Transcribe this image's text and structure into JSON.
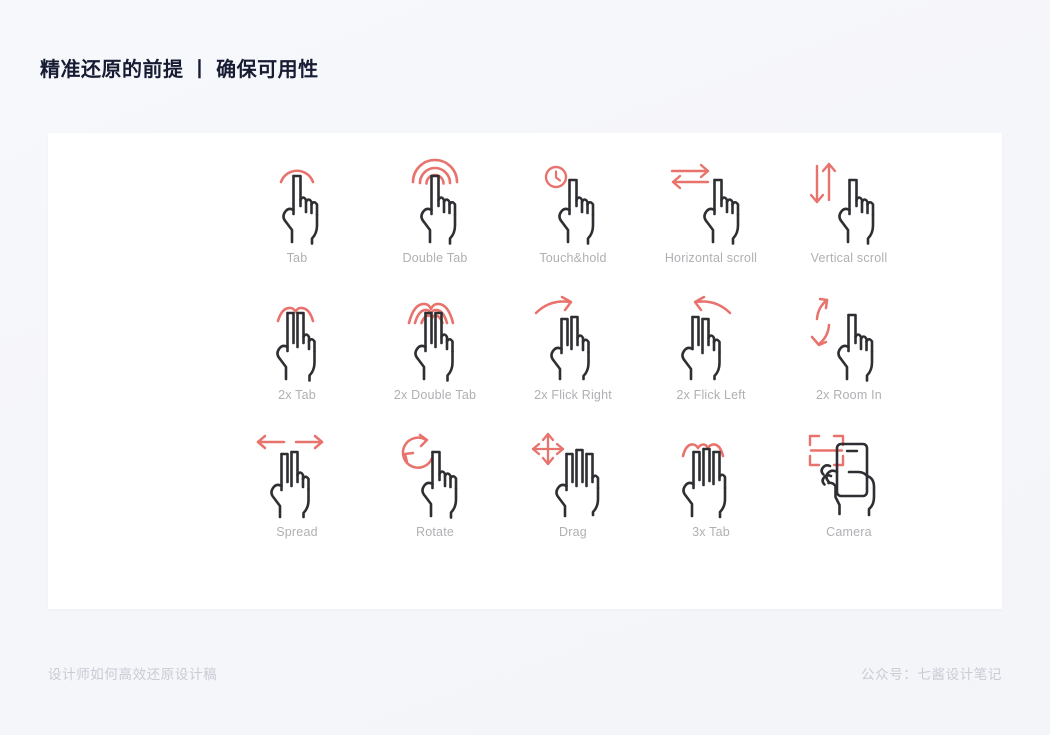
{
  "page": {
    "title": "精准还原的前提 丨 确保可用性",
    "background_color": "#f6f7fb",
    "card_color": "#ffffff",
    "accent_color": "#e8726c",
    "stroke_color": "#2f2f33",
    "label_color": "#b0b0b4"
  },
  "gestures": [
    {
      "label": "Tab",
      "icon": "one-finger-tap-icon"
    },
    {
      "label": "Double Tab",
      "icon": "one-finger-double-tap-icon"
    },
    {
      "label": "Touch&hold",
      "icon": "one-finger-touch-hold-icon"
    },
    {
      "label": "Horizontal scroll",
      "icon": "one-finger-horizontal-scroll-icon"
    },
    {
      "label": "Vertical scroll",
      "icon": "one-finger-vertical-scroll-icon"
    },
    {
      "label": "2x Tab",
      "icon": "two-finger-tap-icon"
    },
    {
      "label": "2x Double Tab",
      "icon": "two-finger-double-tap-icon"
    },
    {
      "label": "2x Flick Right",
      "icon": "two-finger-flick-right-icon"
    },
    {
      "label": "2x Flick Left",
      "icon": "two-finger-flick-left-icon"
    },
    {
      "label": "2x Room In",
      "icon": "two-finger-zoom-in-icon"
    },
    {
      "label": "Spread",
      "icon": "two-finger-spread-icon"
    },
    {
      "label": "Rotate",
      "icon": "one-finger-rotate-icon"
    },
    {
      "label": "Drag",
      "icon": "three-finger-drag-icon"
    },
    {
      "label": "3x Tab",
      "icon": "three-finger-tap-icon"
    },
    {
      "label": "Camera",
      "icon": "camera-phone-scan-icon"
    }
  ],
  "footer": {
    "left": "设计师如何高效还原设计稿",
    "right": "公众号：七酱设计笔记"
  }
}
